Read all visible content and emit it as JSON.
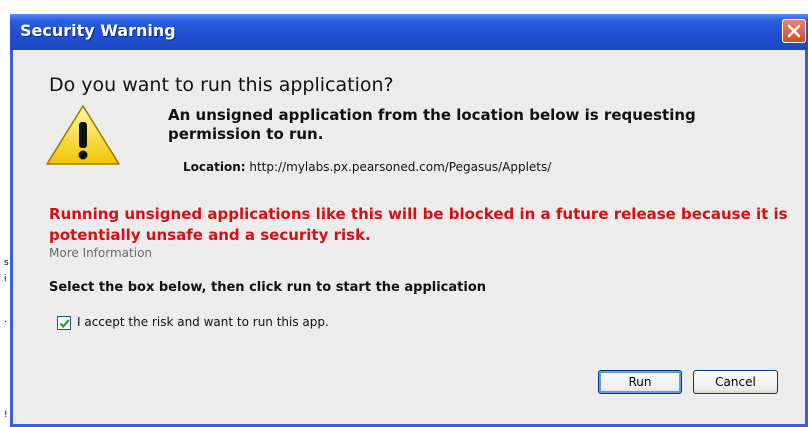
{
  "window": {
    "title": "Security Warning"
  },
  "dialog": {
    "heading": "Do you want to run this application?",
    "description": "An unsigned application from the location below is requesting permission to run.",
    "location_label": "Location:",
    "location_value": "http://mylabs.px.pearsoned.com/Pegasus/Applets/",
    "warning": "Running unsigned applications like this will be blocked in a future release because it is potentially unsafe and a security risk.",
    "more_info_link": "More Information",
    "instruction": "Select the box below, then click run to start the application",
    "checkbox_label": "I accept the risk and want to run this app.",
    "checkbox_checked": true
  },
  "buttons": {
    "run": "Run",
    "cancel": "Cancel"
  },
  "icons": {
    "warning": "warning-triangle-icon",
    "close": "close-icon",
    "check": "check-icon"
  },
  "colors": {
    "titlebar": "#1f4fd2",
    "warning_text": "#d80f12",
    "client": "#ececec",
    "close_button": "#d04a22"
  }
}
